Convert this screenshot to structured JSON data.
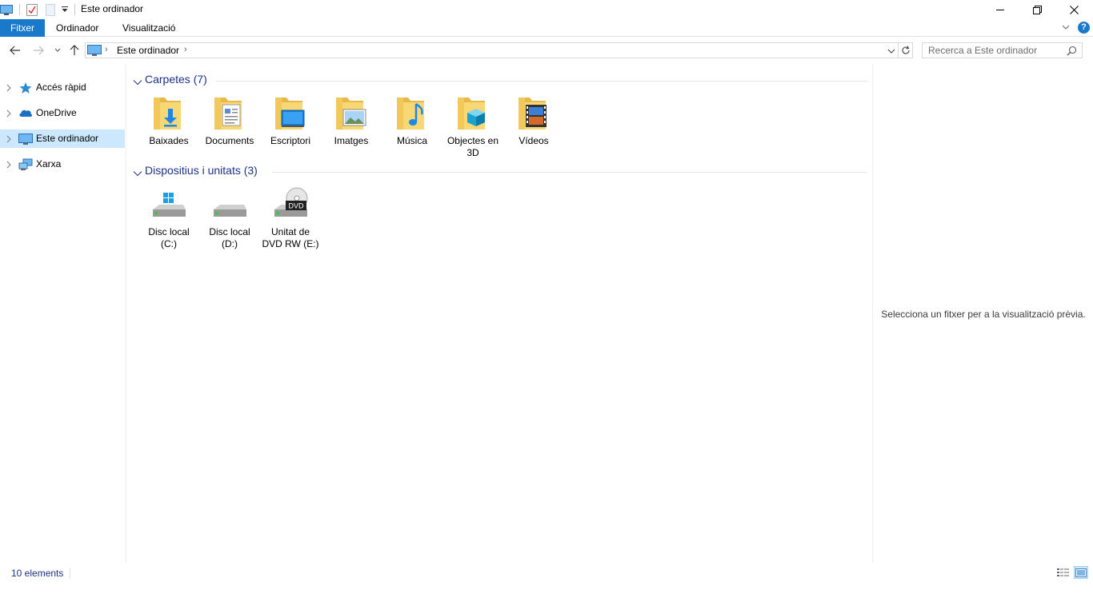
{
  "window": {
    "title": "Este ordinador",
    "controls": [
      "minimize",
      "restore",
      "close"
    ]
  },
  "ribbon": {
    "tabs": [
      {
        "label": "Fitxer"
      },
      {
        "label": "Ordinador"
      },
      {
        "label": "Visualització"
      }
    ]
  },
  "address": {
    "crumb": "Este ordinador"
  },
  "search": {
    "placeholder": "Recerca a Este ordinador"
  },
  "sidebar": {
    "items": [
      {
        "label": "Accés ràpid",
        "icon": "star-icon"
      },
      {
        "label": "OneDrive",
        "icon": "cloud-icon"
      },
      {
        "label": "Este ordinador",
        "icon": "computer-icon",
        "selected": true
      },
      {
        "label": "Xarxa",
        "icon": "network-icon"
      }
    ]
  },
  "groups": {
    "folders": {
      "label": "Carpetes (7)",
      "items": [
        {
          "label": "Baixades",
          "icon": "downloads-folder-icon"
        },
        {
          "label": "Documents",
          "icon": "documents-folder-icon"
        },
        {
          "label": "Escriptori",
          "icon": "desktop-folder-icon"
        },
        {
          "label": "Imatges",
          "icon": "pictures-folder-icon"
        },
        {
          "label": "Música",
          "icon": "music-folder-icon"
        },
        {
          "label": "Objectes en 3D",
          "icon": "3d-objects-folder-icon"
        },
        {
          "label": "Vídeos",
          "icon": "videos-folder-icon"
        }
      ]
    },
    "devices": {
      "label": "Dispositius i unitats (3)",
      "items": [
        {
          "label": "Disc local (C:)",
          "icon": "system-drive-icon"
        },
        {
          "label": "Disc local (D:)",
          "icon": "drive-icon"
        },
        {
          "label": "Unitat de DVD RW (E:)",
          "icon": "dvd-drive-icon",
          "badge": "DVD"
        }
      ]
    }
  },
  "preview": {
    "message": "Selecciona un fitxer per a la visualització prèvia."
  },
  "status": {
    "count": "10 elements"
  },
  "colors": {
    "accent": "#1979ca",
    "selection": "#cce8ff",
    "group_text": "#1e3287",
    "folder": "#f8d775"
  }
}
